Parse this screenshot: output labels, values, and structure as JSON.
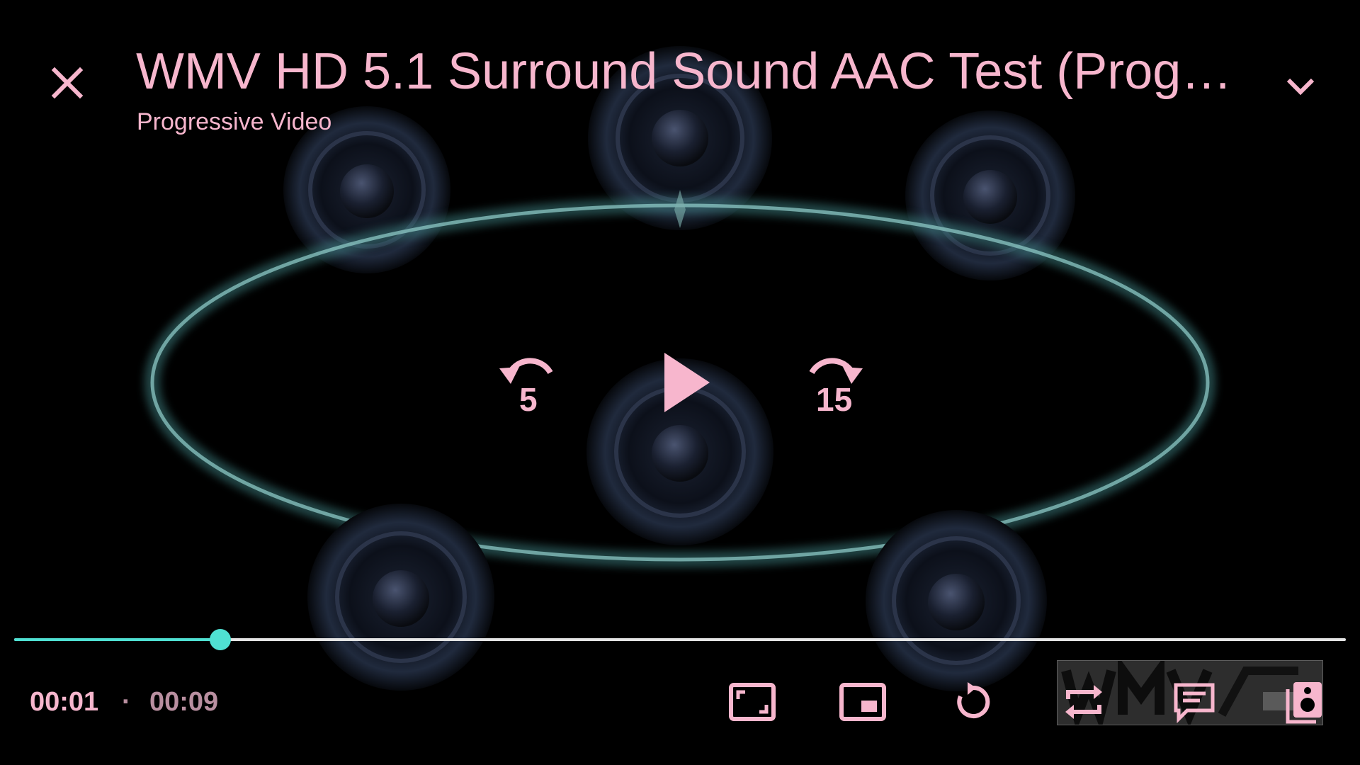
{
  "theme": {
    "accent": "#f7b6cd",
    "seek_played": "#4fe0d2",
    "seek_track": "#e4e4e4",
    "background": "#000000"
  },
  "header": {
    "title": "WMV HD 5.1 Surround Sound AAC Test (Progre…",
    "subtitle": "Progressive Video",
    "close_icon": "close-icon",
    "collapse_icon": "chevron-down-icon"
  },
  "center_controls": {
    "rewind_label": "5",
    "forward_label": "15",
    "play_icon": "play-icon"
  },
  "playback": {
    "current_time": "00:01",
    "separator": "·",
    "total_time": "00:09",
    "progress_fraction": 0.155
  },
  "bottom_controls": [
    "aspect-ratio-icon",
    "picture-in-picture-icon",
    "rotate-icon",
    "repeat-icon",
    "subtitles-icon",
    "audio-track-icon"
  ],
  "watermark": {
    "text": "WMV HD"
  }
}
